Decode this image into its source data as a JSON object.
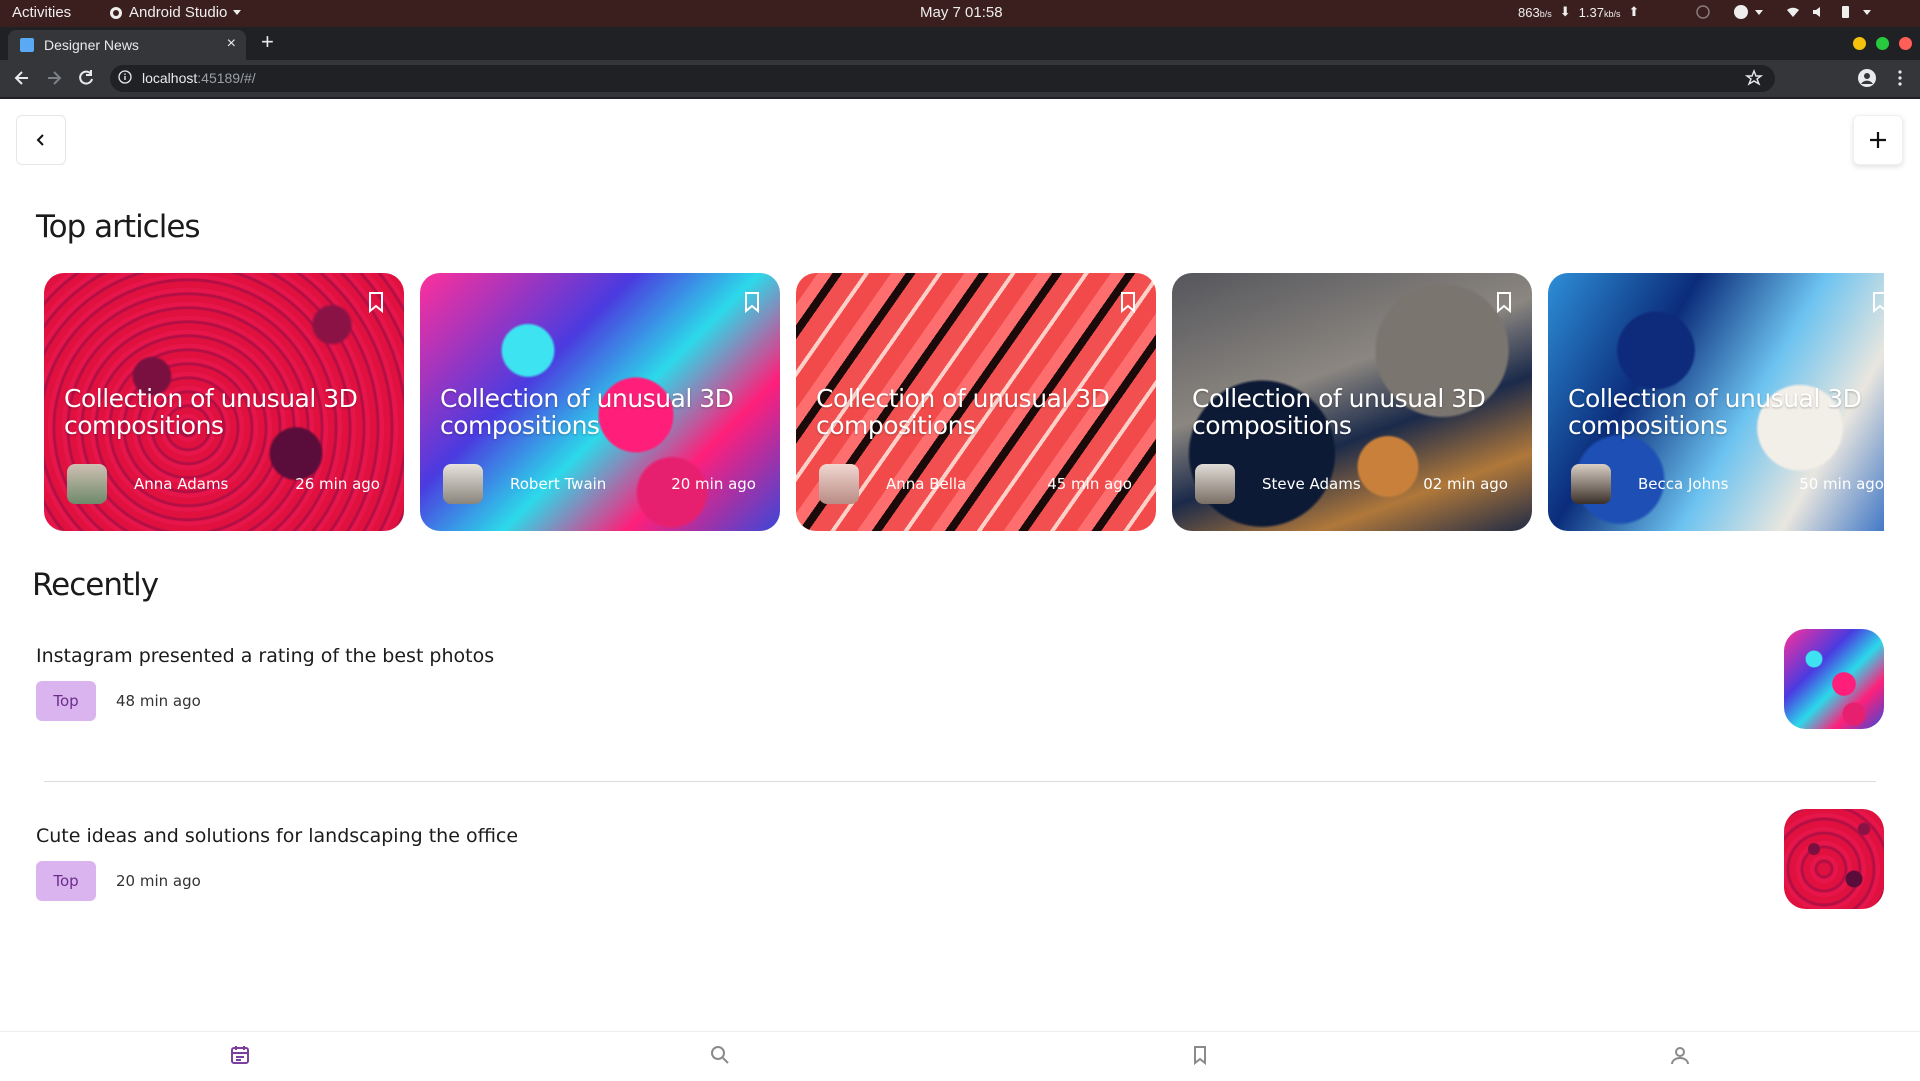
{
  "system_bar": {
    "activities": "Activities",
    "app_name": "Android Studio",
    "clock": "May 7  01:58",
    "net_down_value": "863",
    "net_down_unit": "b/s",
    "net_up_value": "1.37",
    "net_up_unit": "kb/s"
  },
  "browser": {
    "tab_title": "Designer News",
    "tab_close": "×",
    "new_tab": "+",
    "url_host": "localhost",
    "url_rest": ":45189/#/"
  },
  "page": {
    "top_articles_title": "Top articles",
    "recently_title": "Recently"
  },
  "top_articles": [
    {
      "title": "Collection of unusual 3D compositions",
      "author": "Anna Adams",
      "time": "26 min ago"
    },
    {
      "title": "Collection of unusual 3D compositions",
      "author": "Robert Twain",
      "time": "20 min ago"
    },
    {
      "title": "Collection of unusual 3D compositions",
      "author": "Anna Bella",
      "time": "45 min ago"
    },
    {
      "title": "Collection of unusual 3D compositions",
      "author": "Steve Adams",
      "time": "02 min ago"
    },
    {
      "title": "Collection of unusual 3D compositions",
      "author": "Becca Johns",
      "time": "50 min ago"
    }
  ],
  "recent_articles": [
    {
      "title": "Instagram presented a rating of the best photos",
      "tag": "Top",
      "time": "48 min ago"
    },
    {
      "title": "Cute ideas and solutions for landscaping the office",
      "tag": "Top",
      "time": "20 min ago"
    }
  ],
  "bottom_nav": {
    "items": [
      "calendar-icon",
      "search-icon",
      "bookmark-icon",
      "profile-icon"
    ],
    "active_index": 0,
    "active_color": "#7b3fa0",
    "inactive_color": "#8a8a8a"
  },
  "colors": {
    "tag_bg": "#dab4ee",
    "tag_text": "#6b2d8c"
  }
}
